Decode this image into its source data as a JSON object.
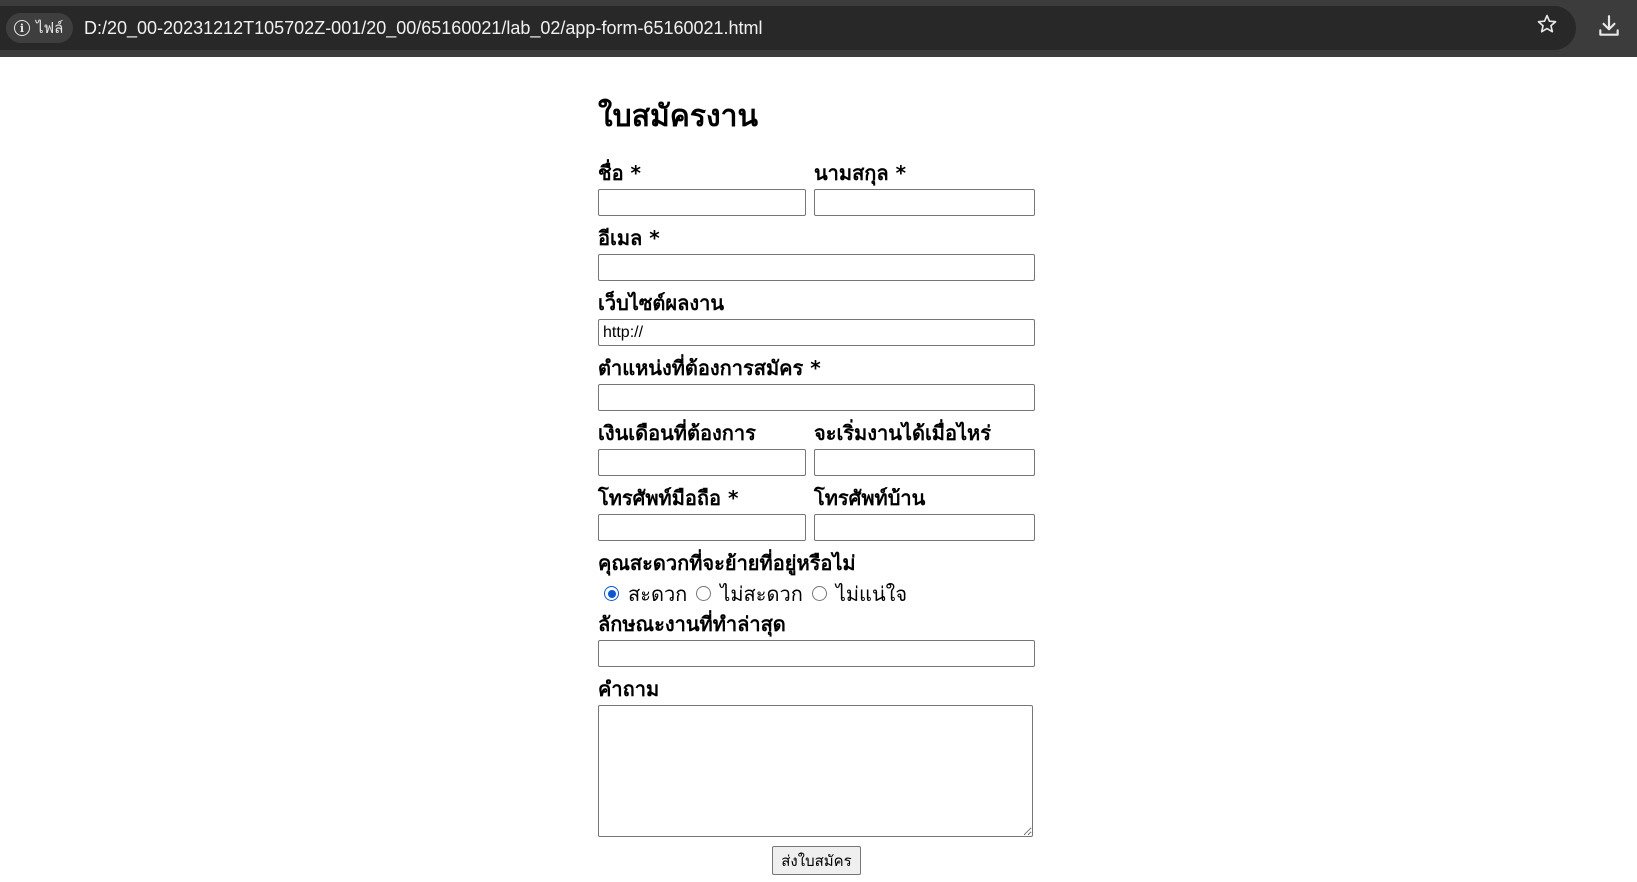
{
  "browser": {
    "site_chip_label": "ไฟล์",
    "url": "D:/20_00-20231212T105702Z-001/20_00/65160021/lab_02/app-form-65160021.html"
  },
  "form": {
    "title": "ใบสมัครงาน",
    "first_name_label": "ชื่อ *",
    "last_name_label": "นามสกุล *",
    "email_label": "อีเมล *",
    "website_label": "เว็บไซต์ผลงาน",
    "website_value": "http://",
    "position_label": "ตำแหน่งที่ต้องการสมัคร *",
    "salary_label": "เงินเดือนที่ต้องการ",
    "start_date_label": "จะเริ่มงานได้เมื่อไหร่",
    "mobile_label": "โทรศัพท์มือถือ *",
    "home_phone_label": "โทรศัพท์บ้าน",
    "relocate_label": "คุณสะดวกที่จะย้ายที่อยู่หรือไม่",
    "relocate_options": [
      {
        "label": "สะดวก",
        "checked": true
      },
      {
        "label": "ไม่สะดวก",
        "checked": false
      },
      {
        "label": "ไม่แน่ใจ",
        "checked": false
      }
    ],
    "last_job_label": "ลักษณะงานที่ทำล่าสุด",
    "question_label": "คำถาม",
    "submit_label": "ส่งใบสมัคร"
  }
}
